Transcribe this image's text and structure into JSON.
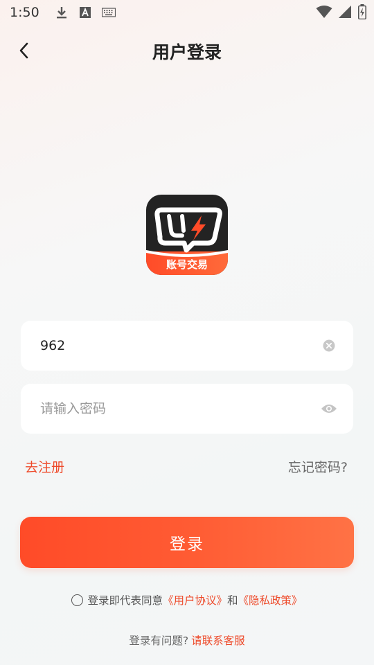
{
  "status_bar": {
    "time": "1:50",
    "icons_left": [
      "download-icon",
      "a-badge-icon",
      "keyboard-icon"
    ],
    "icons_right": [
      "wifi-icon",
      "signal-icon",
      "battery-icon"
    ]
  },
  "nav": {
    "title": "用户登录",
    "back_icon": "chevron-left-icon"
  },
  "logo": {
    "caption": "账号交易",
    "dark_color": "#222222",
    "accent_color": "#ff4b28"
  },
  "form": {
    "username_value": "962",
    "username_clear_icon": "clear-circle-icon",
    "password_placeholder": "请输入密码",
    "password_toggle_icon": "eye-icon"
  },
  "links": {
    "register": "去注册",
    "forgot_password": "忘记密码?"
  },
  "login_button": {
    "label": "登录"
  },
  "agreement": {
    "prefix": "登录即代表同意",
    "user_agreement": "《用户协议》",
    "conjunction": "和",
    "privacy_policy": "《隐私政策》"
  },
  "help": {
    "question": "登录有问题?",
    "contact": "请联系客服"
  },
  "colors": {
    "accent": "#ee4a2a",
    "button_start": "#ff4b28",
    "button_end": "#ff7245"
  }
}
